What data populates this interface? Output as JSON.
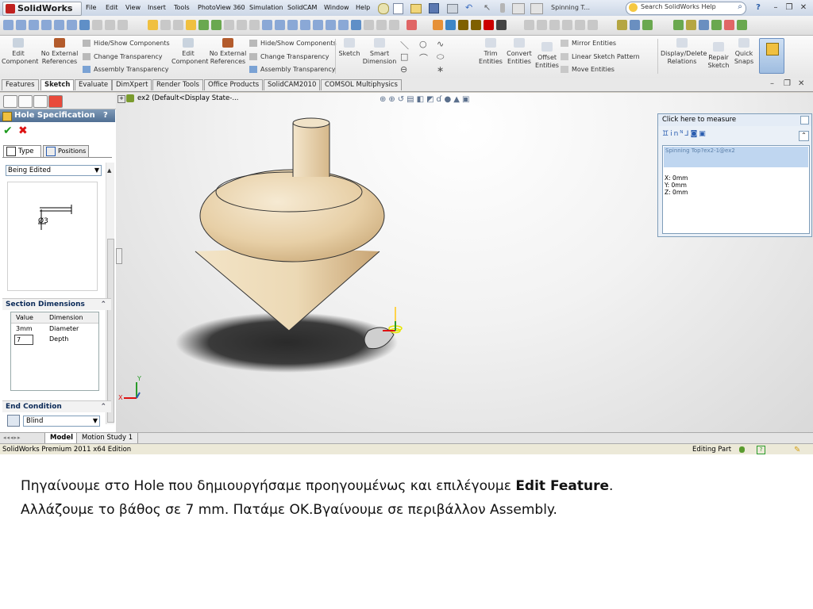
{
  "app": {
    "logo_text": "SolidWorks",
    "brand_color": "#c0211f"
  },
  "menu": [
    "File",
    "Edit",
    "View",
    "Insert",
    "Tools",
    "PhotoView 360",
    "Simulation",
    "SolidCAM",
    "Window",
    "Help"
  ],
  "title_doc": "Spinning T...",
  "search": {
    "placeholder": "Search SolidWorks Help"
  },
  "command_manager": {
    "edit_component": "Edit Component",
    "no_external_references": "No External References",
    "hide_show_components": "Hide/Show Components",
    "change_transparency": "Change Transparency",
    "assembly_transparency": "Assembly Transparency",
    "sketch": "Sketch",
    "smart_dimension": "Smart Dimension",
    "trim_entities": "Trim Entities",
    "convert_entities": "Convert Entities",
    "offset_entities": "Offset Entities",
    "mirror_entities": "Mirror Entities",
    "linear_sketch_pattern": "Linear Sketch Pattern",
    "move_entities": "Move Entities",
    "display_delete_relations": "Display/Delete Relations",
    "repair_sketch": "Repair Sketch",
    "quick_snaps": "Quick Snaps"
  },
  "tabs": [
    "Features",
    "Sketch",
    "Evaluate",
    "DimXpert",
    "Render Tools",
    "Office Products",
    "SolidCAM2010",
    "COMSOL Multiphysics"
  ],
  "active_tab": "Sketch",
  "tree_path": "ex2  (Default<Display State-...",
  "property_manager": {
    "title": "Hole Specification",
    "help": "?",
    "type_tab": "Type",
    "positions_tab": "Positions",
    "being_edited": "Being Edited",
    "preview_label": "Ø3",
    "section_dimensions": {
      "title": "Section Dimensions",
      "headers": [
        "Value",
        "Dimension"
      ],
      "rows": [
        {
          "value": "3mm",
          "dimension": "Diameter"
        },
        {
          "value": "7",
          "dimension": "Depth"
        }
      ]
    },
    "end_condition": {
      "title": "End Condition",
      "value": "Blind"
    }
  },
  "measure": {
    "title": "Click here to measure",
    "selection": "Spinning Top?ex2-1@ex2",
    "x": "X: 0mm",
    "y": "Y: 0mm",
    "z": "Z: 0mm"
  },
  "sheet_tabs": [
    "Model",
    "Motion Study 1"
  ],
  "status": {
    "left": "SolidWorks Premium 2011 x64 Edition",
    "right": "Editing Part"
  },
  "caption": {
    "line1_prefix": "Πηγαίνουμε στο Hole που δημιουργήσαμε προηγουμένως και επιλέγουμε ",
    "line1_bold": "Edit Feature",
    "line1_suffix": ".",
    "line2": "Αλλάζουμε το βάθος σε 7 mm. Πατάμε ΟΚ.Βγαίνουμε σε περιβάλλον Assembly."
  }
}
